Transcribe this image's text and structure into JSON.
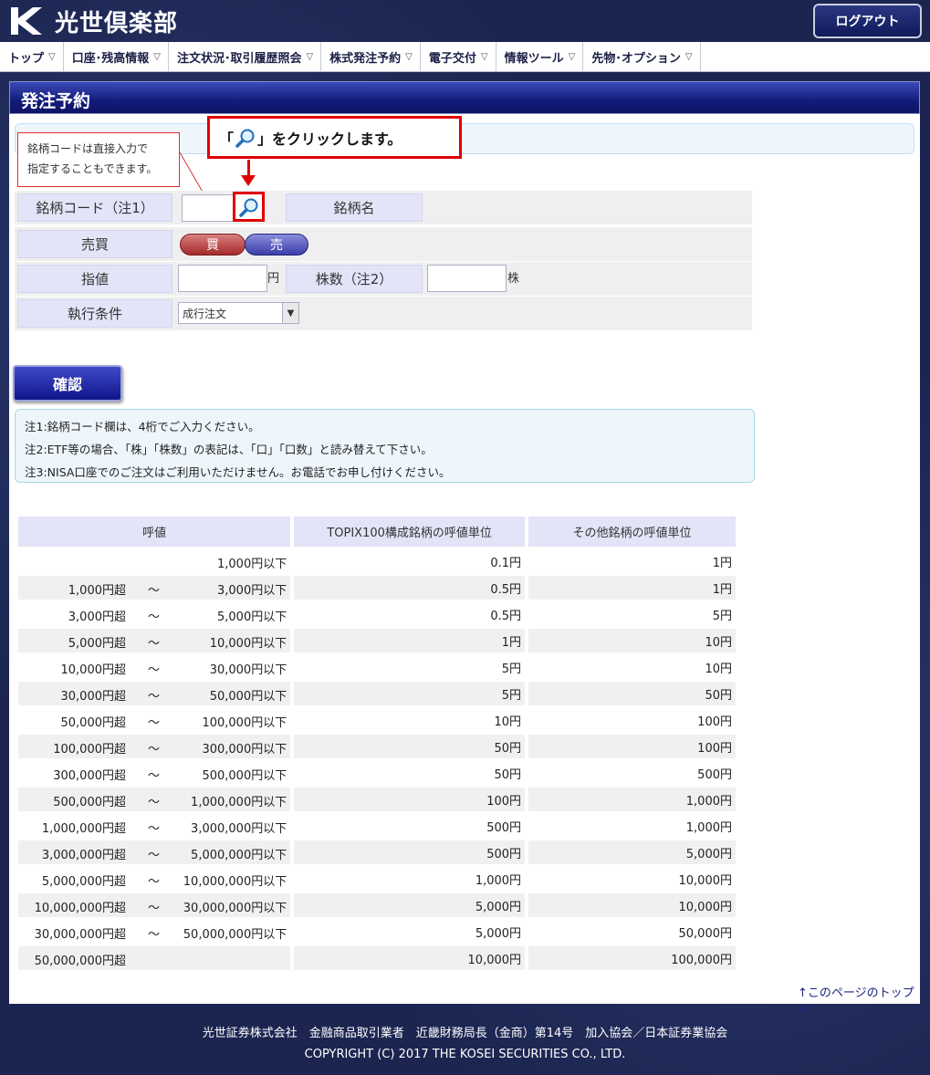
{
  "header": {
    "brand": "光世倶楽部",
    "logout": "ログアウト"
  },
  "nav": [
    {
      "label": "トップ"
    },
    {
      "label": "口座･残高情報"
    },
    {
      "label": "注文状況･取引履歴照会"
    },
    {
      "label": "株式発注予約"
    },
    {
      "label": "電子交付"
    },
    {
      "label": "情報ツール"
    },
    {
      "label": "先物･オプション"
    }
  ],
  "page": {
    "title": "発注予約"
  },
  "annotation": {
    "tip_line1": "銘柄コードは直接入力で",
    "tip_line2": "指定することもできます。",
    "callout_open": "「",
    "callout_close": "」をクリックします。"
  },
  "form": {
    "code_label": "銘柄コード（注1）",
    "code_value": "",
    "name_label": "銘柄名",
    "name_value": "",
    "side_label": "売買",
    "buy": "買",
    "sell": "売",
    "price_label": "指値",
    "price_value": "",
    "price_unit": "円",
    "qty_label": "株数（注2）",
    "qty_value": "",
    "qty_unit": "株",
    "cond_label": "執行条件",
    "cond_value": "成行注文"
  },
  "confirm_button": "確認",
  "notes": [
    "注1:銘柄コード欄は、4桁でご入力ください。",
    "注2:ETF等の場合、「株」「株数」の表記は、「口」「口数」と読み替えて下さい。",
    "注3:NISA口座でのご注文はご利用いただけません。お電話でお申し付けください。"
  ],
  "tick_table": {
    "headers": [
      "呼値",
      "TOPIX100構成銘柄の呼値単位",
      "その他銘柄の呼値単位"
    ],
    "rows": [
      {
        "lo": "",
        "tilde": "",
        "hi": "1,000円以下",
        "topix": "0.1円",
        "other": "1円"
      },
      {
        "lo": "1,000円超",
        "tilde": "～",
        "hi": "3,000円以下",
        "topix": "0.5円",
        "other": "1円"
      },
      {
        "lo": "3,000円超",
        "tilde": "～",
        "hi": "5,000円以下",
        "topix": "0.5円",
        "other": "5円"
      },
      {
        "lo": "5,000円超",
        "tilde": "～",
        "hi": "10,000円以下",
        "topix": "1円",
        "other": "10円"
      },
      {
        "lo": "10,000円超",
        "tilde": "～",
        "hi": "30,000円以下",
        "topix": "5円",
        "other": "10円"
      },
      {
        "lo": "30,000円超",
        "tilde": "～",
        "hi": "50,000円以下",
        "topix": "5円",
        "other": "50円"
      },
      {
        "lo": "50,000円超",
        "tilde": "～",
        "hi": "100,000円以下",
        "topix": "10円",
        "other": "100円"
      },
      {
        "lo": "100,000円超",
        "tilde": "～",
        "hi": "300,000円以下",
        "topix": "50円",
        "other": "100円"
      },
      {
        "lo": "300,000円超",
        "tilde": "～",
        "hi": "500,000円以下",
        "topix": "50円",
        "other": "500円"
      },
      {
        "lo": "500,000円超",
        "tilde": "～",
        "hi": "1,000,000円以下",
        "topix": "100円",
        "other": "1,000円"
      },
      {
        "lo": "1,000,000円超",
        "tilde": "～",
        "hi": "3,000,000円以下",
        "topix": "500円",
        "other": "1,000円"
      },
      {
        "lo": "3,000,000円超",
        "tilde": "～",
        "hi": "5,000,000円以下",
        "topix": "500円",
        "other": "5,000円"
      },
      {
        "lo": "5,000,000円超",
        "tilde": "～",
        "hi": "10,000,000円以下",
        "topix": "1,000円",
        "other": "10,000円"
      },
      {
        "lo": "10,000,000円超",
        "tilde": "～",
        "hi": "30,000,000円以下",
        "topix": "5,000円",
        "other": "10,000円"
      },
      {
        "lo": "30,000,000円超",
        "tilde": "～",
        "hi": "50,000,000円以下",
        "topix": "5,000円",
        "other": "50,000円"
      },
      {
        "lo": "50,000,000円超",
        "tilde": "",
        "hi": "",
        "topix": "10,000円",
        "other": "100,000円"
      }
    ]
  },
  "page_top_link": "↑このページのトップへ",
  "footer": {
    "line1": "光世証券株式会社　金融商品取引業者　近畿財務局長（金商）第14号　加入協会／日本証券業協会",
    "line2": "COPYRIGHT (C) 2017 THE KOSEI SECURITIES CO., LTD."
  },
  "icons": {
    "search": "magnifier-icon",
    "logo": "k-logo-icon"
  },
  "colors": {
    "accent": "#131c7a",
    "highlight": "#e00000"
  }
}
